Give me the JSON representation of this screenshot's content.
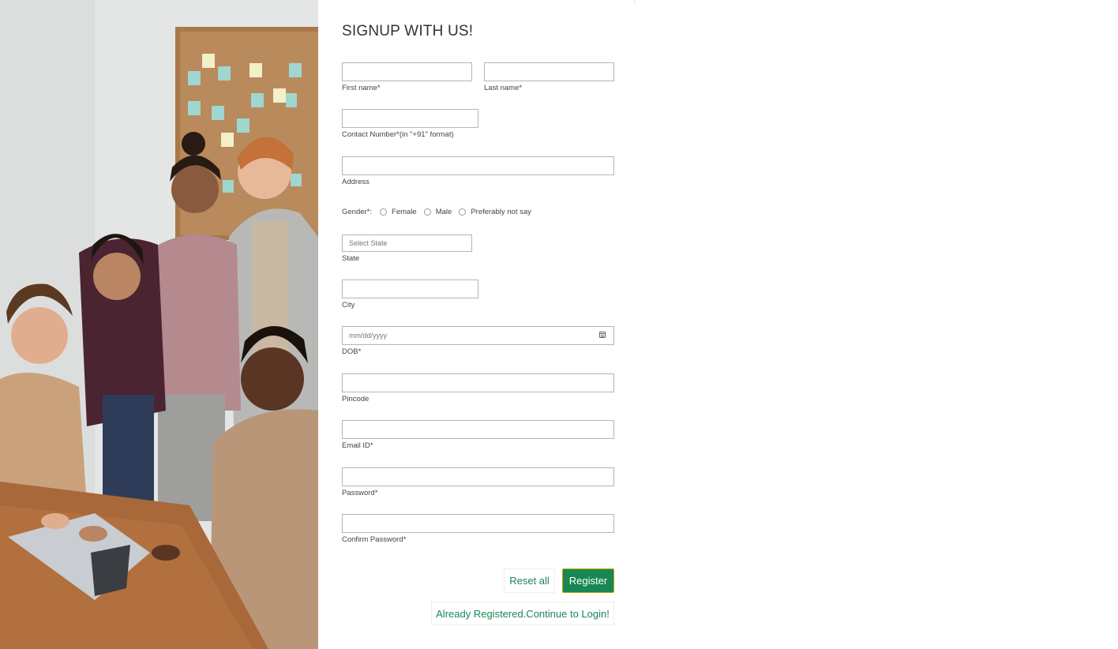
{
  "form": {
    "title": "SIGNUP WITH US!",
    "fields": {
      "first_name": {
        "label": "First name*",
        "value": ""
      },
      "last_name": {
        "label": "Last name*",
        "value": ""
      },
      "contact": {
        "label": "Contact Number*(in \"+91\" format)",
        "value": ""
      },
      "address": {
        "label": "Address",
        "value": ""
      },
      "state": {
        "label": "State",
        "placeholder": "Select State",
        "value": ""
      },
      "city": {
        "label": "City",
        "value": ""
      },
      "dob": {
        "label": "DOB*",
        "placeholder": "mm/dd/yyyy",
        "value": ""
      },
      "pincode": {
        "label": "Pincode",
        "value": ""
      },
      "email": {
        "label": "Email ID*",
        "value": ""
      },
      "password": {
        "label": "Password*",
        "value": ""
      },
      "confirm_password": {
        "label": "Confirm Password*",
        "value": ""
      }
    },
    "gender": {
      "label": "Gender*:",
      "options": [
        "Female",
        "Male",
        "Preferably not say"
      ],
      "selected": null
    },
    "buttons": {
      "reset": "Reset all",
      "register": "Register",
      "login": "Already Registered.Continue to Login!"
    }
  },
  "colors": {
    "primary_green": "#198754",
    "input_border": "#b5b5b5"
  },
  "icons": {
    "dob": "calendar-icon"
  }
}
